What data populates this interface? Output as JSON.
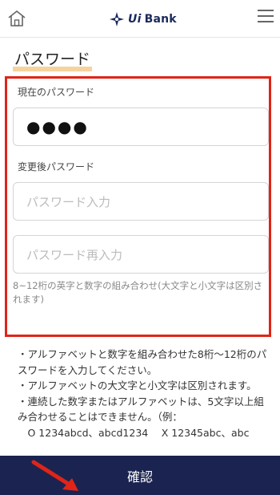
{
  "header": {
    "brand_name": "Bank",
    "brand_prefix": "Ui",
    "home_icon": "home-icon",
    "menu_icon": "hamburger-menu-icon"
  },
  "page": {
    "title": "パスワード"
  },
  "form": {
    "current_label": "現在のパスワード",
    "current_value": "●●●●",
    "new_label": "変更後パスワード",
    "new_placeholder": "パスワード入力",
    "confirm_placeholder": "パスワード再入力",
    "hint": "8~12桁の英字と数字の組み合わせ(大文字と小文字は区別されます)"
  },
  "notes": [
    "・アルファベットと数字を組み合わせた8桁〜12桁のパスワードを入力してください。",
    "・アルファベットの大文字と小文字は区別されます。",
    "・連続した数字またはアルファベットは、5文字以上組み合わせることはできません。（例：",
    "　O 1234abcd、abcd1234　 X 12345abc、abc"
  ],
  "footer": {
    "confirm_label": "確認"
  },
  "colors": {
    "highlight_frame": "#e02418",
    "confirm_bar": "#1b2450",
    "title_underline": "#f6d39e"
  }
}
